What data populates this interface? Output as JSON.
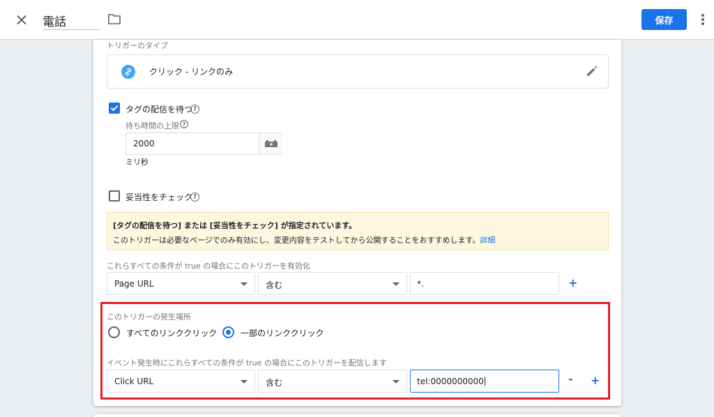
{
  "header": {
    "tag_title": "電話",
    "save_label": "保存"
  },
  "trigger": {
    "type_label": "トリガーのタイプ",
    "type_value": "クリック - リンクのみ",
    "wait_for_tags_label": "タグの配信を待つ",
    "wait_for_tags_checked": true,
    "max_wait_label": "待ち時間の上限",
    "max_wait_value": "2000",
    "max_wait_unit": "ミリ秒",
    "check_validation_label": "妥当性をチェック",
    "check_validation_checked": false
  },
  "warning": {
    "title": "[タグの配信を待つ] または [妥当性をチェック] が指定されています。",
    "body": "このトリガーは必要なページでのみ有効にし、変更内容をテストしてから公開することをおすすめします。",
    "link": "詳細"
  },
  "enable_conditions": {
    "label": "これらすべての条件が true の場合にこのトリガーを有効化",
    "variable": "Page URL",
    "operator": "含む",
    "value": "*."
  },
  "fire_on": {
    "label": "このトリガーの発生場所",
    "options": [
      "すべてのリンククリック",
      "一部のリンククリック"
    ],
    "selected_index": 1,
    "conditions_label": "イベント発生時にこれらすべての条件が true の場合にこのトリガーを配信します",
    "variable": "Click URL",
    "operator": "含む",
    "value": "tel:0000000000"
  },
  "symbols": {
    "help": "?",
    "plus": "+",
    "minus": "-"
  },
  "colors": {
    "accent": "#1a73e8",
    "highlight_border": "#e21f26",
    "warning_bg": "#fef7e0"
  }
}
